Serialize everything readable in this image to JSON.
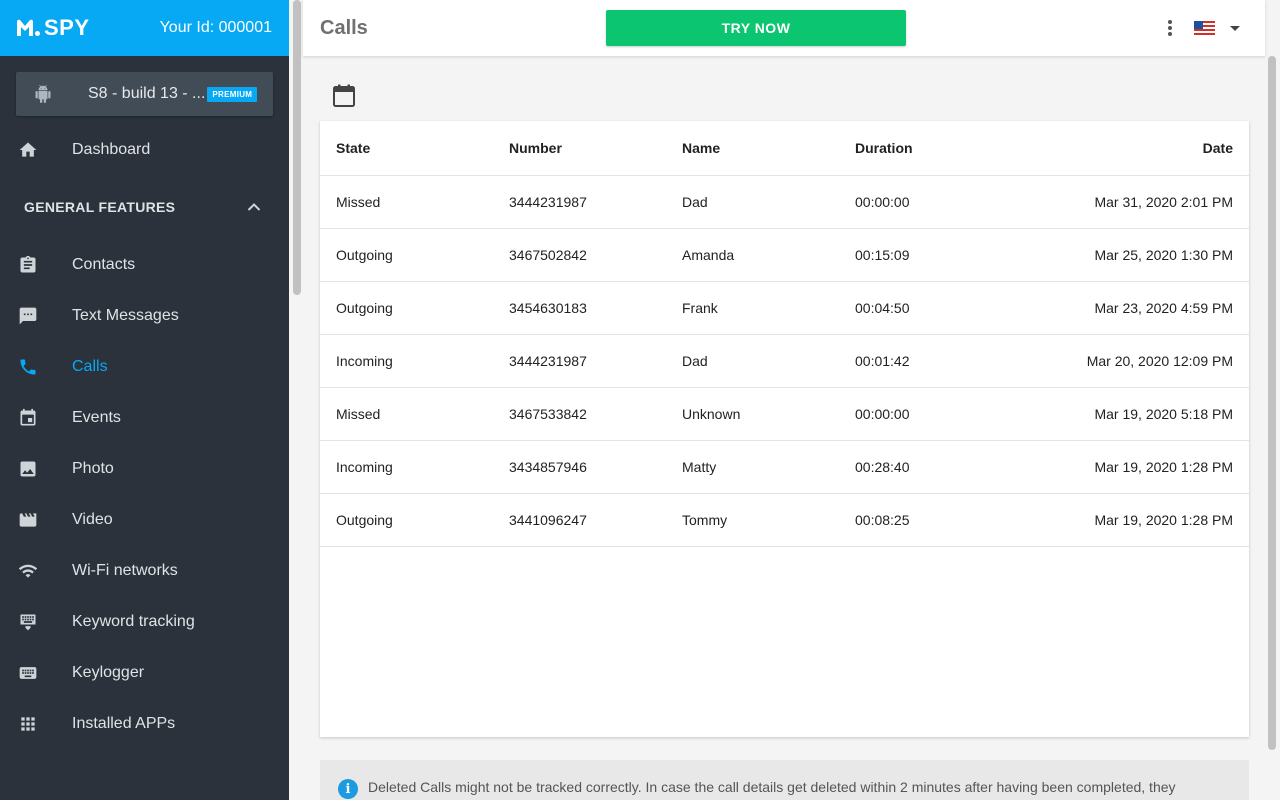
{
  "brand": {
    "logo_text": "SPY",
    "user_id": "Your Id: 000001",
    "accent": "#07a9f5"
  },
  "device": {
    "name": "S8 - build 13 - ...",
    "badge": "PREMIUM",
    "icon": "android-icon"
  },
  "sidebar": {
    "dashboard": {
      "label": "Dashboard",
      "icon": "home-icon"
    },
    "section_title": "GENERAL FEATURES",
    "items": [
      {
        "label": "Contacts",
        "icon": "contacts-icon"
      },
      {
        "label": "Text Messages",
        "icon": "message-icon"
      },
      {
        "label": "Calls",
        "icon": "phone-icon",
        "active": true
      },
      {
        "label": "Events",
        "icon": "calendar-icon"
      },
      {
        "label": "Photo",
        "icon": "image-icon"
      },
      {
        "label": "Video",
        "icon": "video-icon"
      },
      {
        "label": "Wi-Fi networks",
        "icon": "wifi-icon"
      },
      {
        "label": "Keyword tracking",
        "icon": "keyword-icon"
      },
      {
        "label": "Keylogger",
        "icon": "keyboard-icon"
      },
      {
        "label": "Installed APPs",
        "icon": "apps-icon"
      }
    ]
  },
  "header": {
    "title": "Calls",
    "try_label": "TRY NOW",
    "try_color": "#0cc571"
  },
  "table": {
    "columns": [
      "State",
      "Number",
      "Name",
      "Duration",
      "Date"
    ],
    "rows": [
      [
        "Missed",
        "3444231987",
        "Dad",
        "00:00:00",
        "Mar 31, 2020 2:01 PM"
      ],
      [
        "Outgoing",
        "3467502842",
        "Amanda",
        "00:15:09",
        "Mar 25, 2020 1:30 PM"
      ],
      [
        "Outgoing",
        "3454630183",
        "Frank",
        "00:04:50",
        "Mar 23, 2020 4:59 PM"
      ],
      [
        "Incoming",
        "3444231987",
        "Dad",
        "00:01:42",
        "Mar 20, 2020 12:09 PM"
      ],
      [
        "Missed",
        "3467533842",
        "Unknown",
        "00:00:00",
        "Mar 19, 2020 5:18 PM"
      ],
      [
        "Incoming",
        "3434857946",
        "Matty",
        "00:28:40",
        "Mar 19, 2020 1:28 PM"
      ],
      [
        "Outgoing",
        "3441096247",
        "Tommy",
        "00:08:25",
        "Mar 19, 2020 1:28 PM"
      ]
    ]
  },
  "info": {
    "icon_glyph": "i",
    "text": "Deleted Calls might not be tracked correctly. In case the call details get deleted within 2 minutes after having been completed, they"
  }
}
